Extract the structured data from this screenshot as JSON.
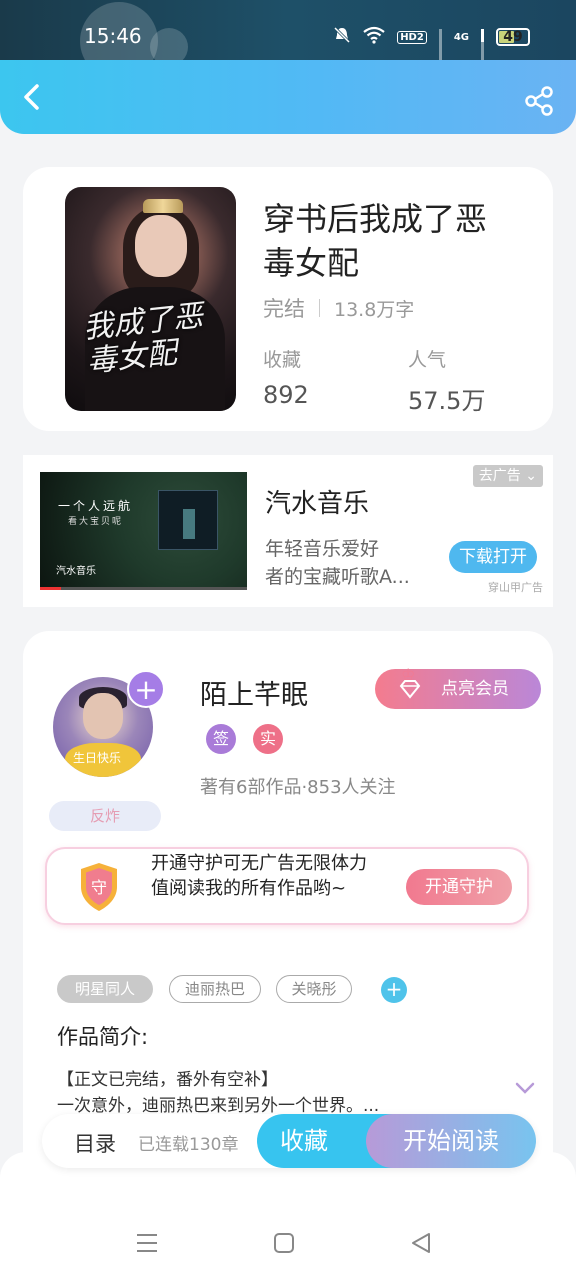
{
  "status_bar": {
    "time": "15:46",
    "hd_label": "HD2",
    "network_label": "4G",
    "battery": "49"
  },
  "header": {
    "icons": [
      "back-icon",
      "share-icon"
    ]
  },
  "book": {
    "title_line1": "穿书后我成了恶",
    "title_line2": "毒女配",
    "status": "完结",
    "word_count": "13.8万字",
    "favorites_label": "收藏",
    "favorites_value": "892",
    "popularity_label": "人气",
    "popularity_value": "57.5万",
    "cover_art_text": "我成了恶毒女配"
  },
  "ad": {
    "title": "汽水音乐",
    "desc_line1": "年轻音乐爱好",
    "desc_line2": "者的宝藏听歌A...",
    "remove_label": "去广告",
    "download_label": "下载打开",
    "source": "穿山甲广告",
    "thumb_text1": "一个人远航",
    "thumb_text2": "看大宝贝呢",
    "thumb_logo": "汽水音乐"
  },
  "author": {
    "name": "陌上芊眠",
    "vip_label": "点亮会员",
    "badge_sign": "签",
    "badge_real": "实",
    "badge_colors": {
      "sign": "#a97bd8",
      "real": "#ee7088"
    },
    "stats": "著有6部作品·853人关注",
    "fan_tag": "反炸",
    "avatar_caption": "生日快乐",
    "follow_symbol": "+"
  },
  "guard": {
    "text": "开通守护可无广告无限体力值阅读我的所有作品哟~",
    "button": "开通守护",
    "shield_glyph": "守"
  },
  "tags": {
    "items": [
      "明星同人",
      "迪丽热巴",
      "关晓彤"
    ],
    "add_symbol": "+"
  },
  "intro": {
    "label": "作品简介:",
    "line1": "【正文已完结，番外有空补】",
    "line2": "一次意外，迪丽热巴来到另外一个世界。..."
  },
  "action_bar": {
    "toc_label": "目录",
    "toc_status": "已连载130章",
    "collect_label": "收藏",
    "read_label": "开始阅读"
  },
  "colors": {
    "accent_blue": "#37c4ef",
    "accent_purple": "#a57de6",
    "accent_pink": "#f1798f"
  }
}
